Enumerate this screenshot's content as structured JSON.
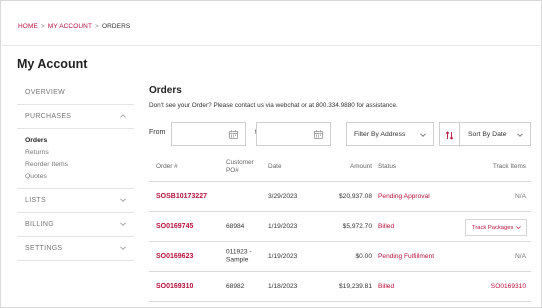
{
  "breadcrumb": {
    "home": "HOME",
    "account": "MY ACCOUNT",
    "current": "ORDERS",
    "separator": ">"
  },
  "account_title": "My Account",
  "sidebar": {
    "overview": "OVERVIEW",
    "purchases": "PURCHASES",
    "purchases_items": [
      "Orders",
      "Returns",
      "Reorder Items",
      "Quotes"
    ],
    "lists": "LISTS",
    "billing": "BILLING",
    "settings": "SETTINGS"
  },
  "main": {
    "title": "Orders",
    "notice": "Don't see your Order? Please contact us via webchat or at 800.334.9880 for assistance."
  },
  "filters": {
    "from_label": "From",
    "from_value": "",
    "to_label": "to",
    "to_value": "",
    "address_filter": "Filter By Address",
    "sort": "Sort By Date"
  },
  "table": {
    "headers": {
      "order": "Order #",
      "customer_po_1": "Customer",
      "customer_po_2": "PO#",
      "date": "Date",
      "amount": "Amount",
      "status": "Status",
      "track": "Track Items"
    },
    "rows": [
      {
        "order": "SOSB10173227",
        "po_1": "",
        "po_2": "",
        "date": "3/29/2023",
        "amount": "$20,937.08",
        "status": "Pending Approval",
        "track": "N/A"
      },
      {
        "order": "SO0169745",
        "po_1": "68984",
        "po_2": "",
        "date": "1/19/2023",
        "amount": "$5,972.70",
        "status": "Billed",
        "track": "Track Packages"
      },
      {
        "order": "SO0169623",
        "po_1": "011923 -",
        "po_2": "Sample",
        "date": "1/19/2023",
        "amount": "$0.00",
        "status": "Pending Fulfillment",
        "track": "N/A"
      },
      {
        "order": "SO0169310",
        "po_1": "68982",
        "po_2": "",
        "date": "1/18/2023",
        "amount": "$19,239.81",
        "status": "Billed",
        "track": "SO0169310"
      }
    ]
  },
  "colors": {
    "accent": "#b5123d",
    "border": "#d9d9d9"
  },
  "icons": {
    "calendar": "calendar-icon",
    "chevron": "chevron-down-icon",
    "sort": "sort-icon"
  }
}
